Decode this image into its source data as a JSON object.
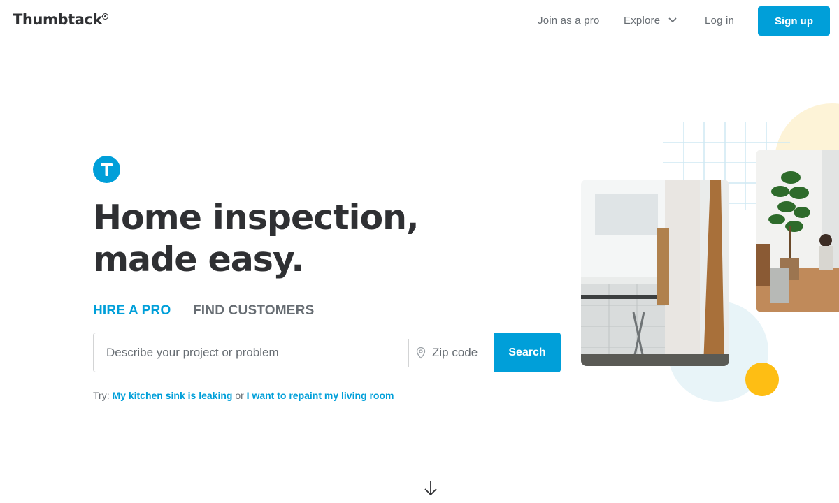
{
  "header": {
    "logo": "Thumbtack",
    "nav": {
      "join": "Join as a pro",
      "explore": "Explore",
      "login": "Log in"
    },
    "signup": "Sign up"
  },
  "hero": {
    "badge_icon": "thumbtack-t-icon",
    "headline_line1": "Home inspection,",
    "headline_line2": "made easy.",
    "tabs": [
      {
        "label": "HIRE A PRO",
        "active": true
      },
      {
        "label": "FIND CUSTOMERS",
        "active": false
      }
    ],
    "search": {
      "project_placeholder": "Describe your project or problem",
      "zip_placeholder": "Zip code",
      "button": "Search"
    },
    "try": {
      "prefix": "Try:",
      "suggestion1": "My kitchen sink is leaking",
      "connector": "or",
      "suggestion2": "I want to repaint my living room"
    }
  },
  "colors": {
    "brand_blue": "#009fd9",
    "text_dark": "#2f3033",
    "text_gray": "#676d73",
    "accent_yellow": "#febe14",
    "accent_light": "#fdf3d7"
  },
  "icons": {
    "explore_chevron": "chevron-down-icon",
    "zip": "map-pin-icon",
    "scroll": "arrow-down-icon"
  }
}
